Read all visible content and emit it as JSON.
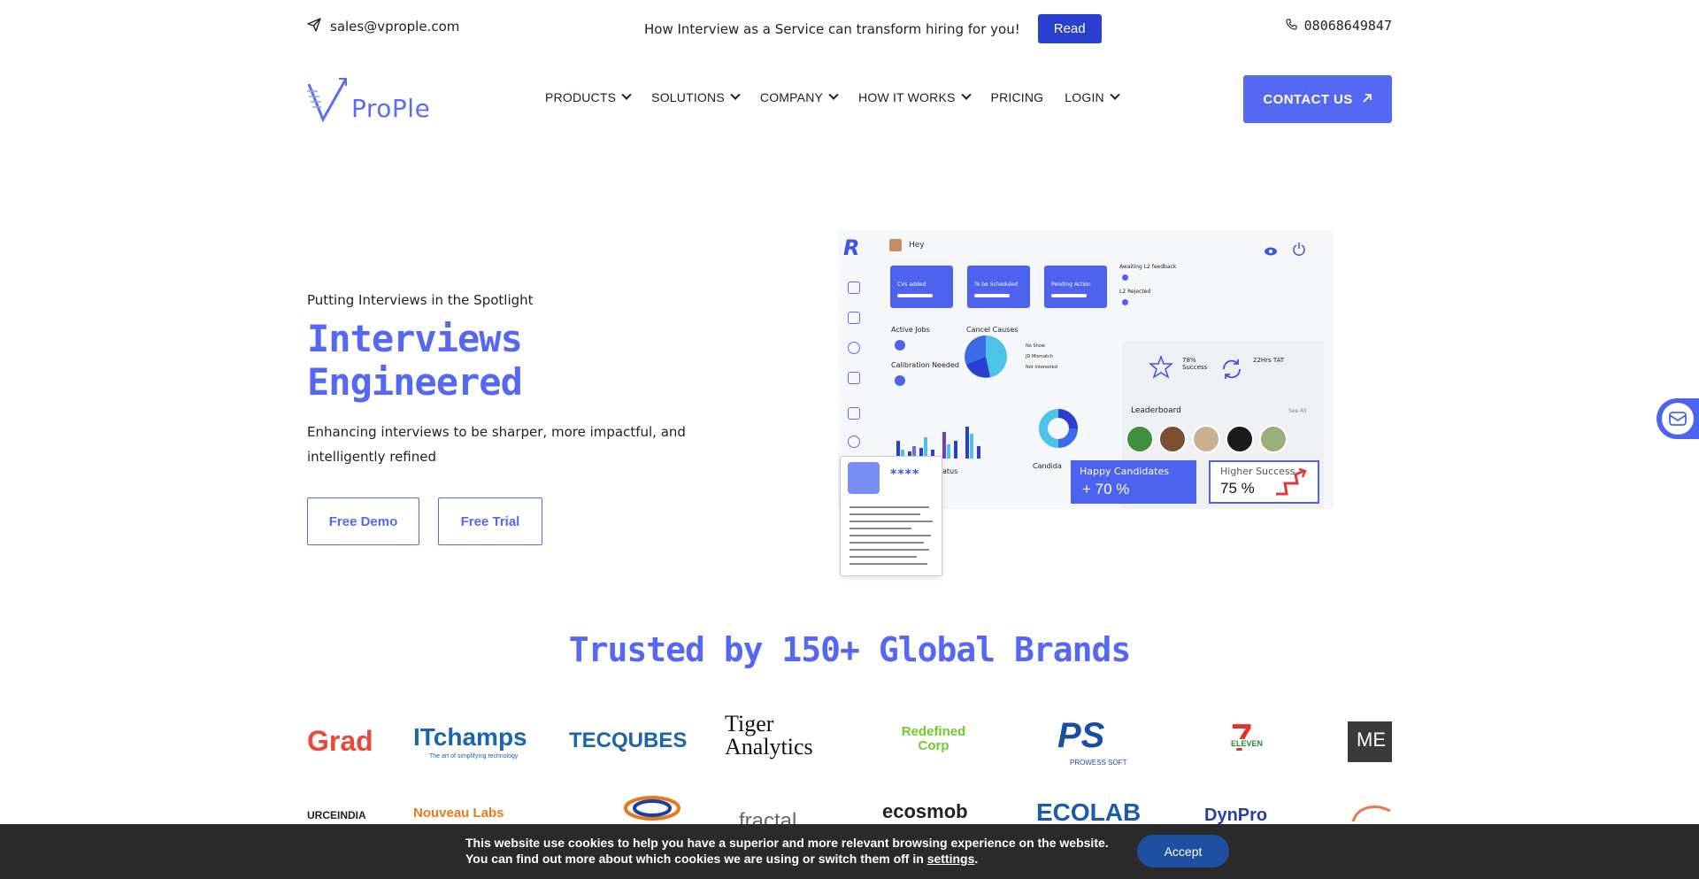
{
  "topbar": {
    "email": "sales@vprople.com",
    "promo_text": "How Interview as a Service can transform hiring for you!",
    "read_label": "Read",
    "phone": "08068649847"
  },
  "nav": {
    "logo_text": "ProPle",
    "items": [
      {
        "label": "PRODUCTS",
        "dropdown": true
      },
      {
        "label": "SOLUTIONS",
        "dropdown": true
      },
      {
        "label": "COMPANY",
        "dropdown": true
      },
      {
        "label": "HOW IT WORKS",
        "dropdown": true
      },
      {
        "label": "PRICING",
        "dropdown": false
      },
      {
        "label": "LOGIN",
        "dropdown": true
      }
    ],
    "contact_label": "CONTACT US"
  },
  "hero": {
    "eyebrow": "Putting Interviews in the Spotlight",
    "title": "Interviews Engineered",
    "description": "Enhancing interviews to be sharper, more impactful, and intelligently refined",
    "demo_label": "Free Demo",
    "trial_label": "Free Trial"
  },
  "dashboard": {
    "greeting": "Hey",
    "stat_cards": [
      "CVs added",
      "To be Scheduled",
      "Pending Action"
    ],
    "awaiting_label": "Awaiting L2 feedback",
    "rejected_label": "L2 Rejected",
    "active_jobs": "Active Jobs",
    "calibration": "Calibration Needed",
    "cancel_causes": "Cancel Causes",
    "cancel_legend": [
      "No Show",
      "JD Mismatch",
      "Not Interested"
    ],
    "success_label": "78% Success",
    "tat_label": "22Hrs TAT",
    "leaderboard": "Leaderboard",
    "see_all": "See All",
    "status_fragment": "atus",
    "candidate_fragment": "Candida",
    "doc_stars": "****"
  },
  "badges": {
    "happy_label": "Happy Candidates",
    "happy_value": "+ 70 %",
    "higher_label": "Higher Success",
    "higher_value": "75 %"
  },
  "trusted": {
    "title": "Trusted by 150+ Global Brands",
    "row1": [
      "Grad",
      "ITchamps",
      "TECQUBES",
      "Tiger Analytics",
      "Redefined Corp",
      "PS",
      "ELEVEN",
      "ME"
    ],
    "row1_sub": {
      "itchamps": "The art of simplifying technology",
      "ps": "PROWESS SOFT"
    },
    "row2": [
      "URCEINDIA",
      "Nouveau Labs",
      "fractal",
      "ecosmob",
      "ECOLAB",
      "DynPro"
    ]
  },
  "cookie": {
    "line1": "This website use cookies to help you have a superior and more relevant browsing experience on the website.",
    "line2_prefix": "You can find out more about which cookies we are using or switch them off in ",
    "settings_link": "settings",
    "line2_suffix": ".",
    "accept_label": "Accept"
  },
  "colors": {
    "brand": "#5468f4",
    "read_button": "#2a3fcf",
    "cookie_bg": "#2a2a2a",
    "accept_button": "#1e4fa0"
  }
}
